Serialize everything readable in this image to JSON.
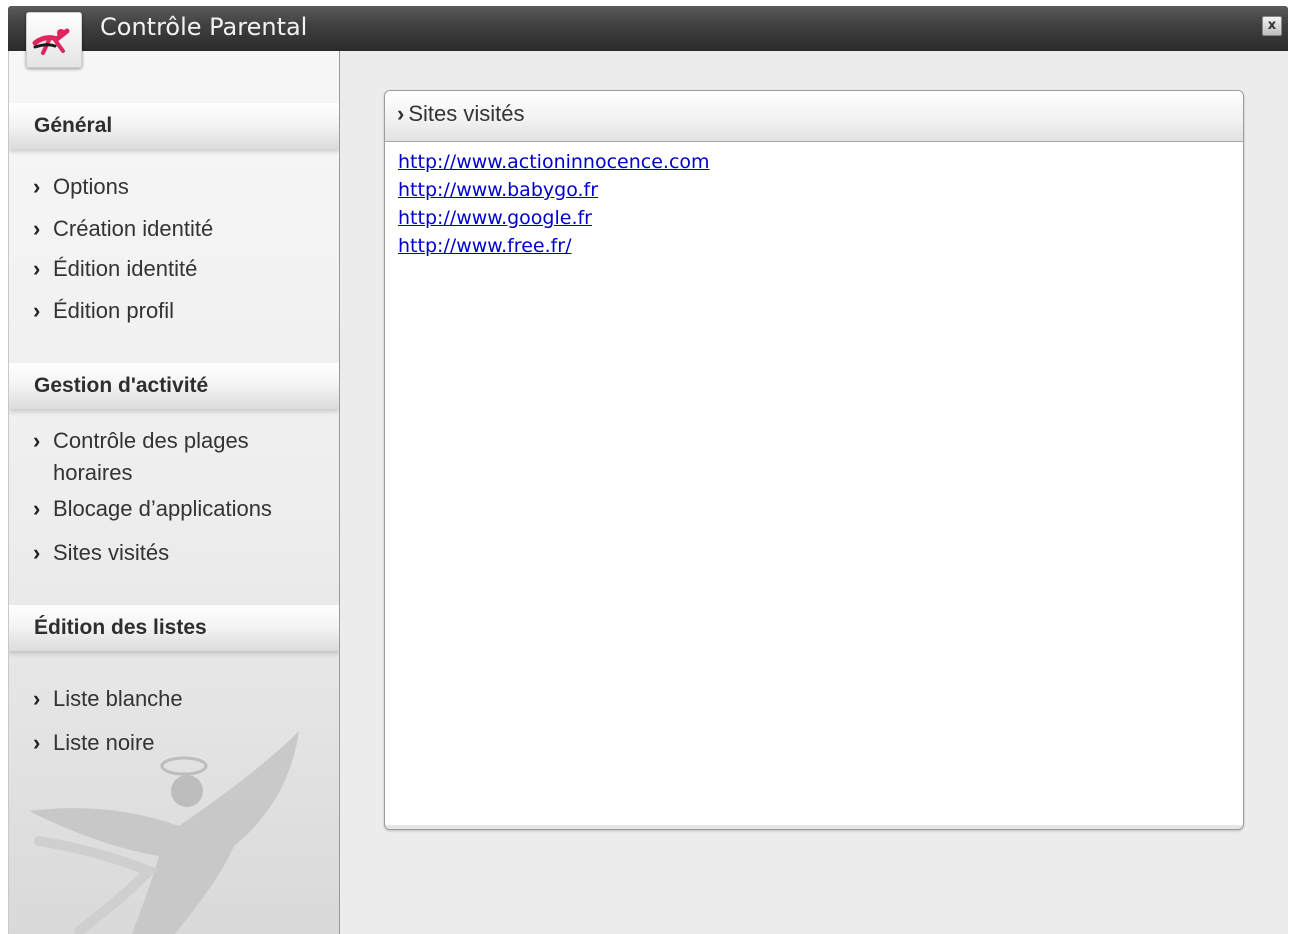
{
  "window": {
    "title": "Contrôle Parental",
    "close_label": "x"
  },
  "sidebar": {
    "sections": [
      {
        "title": "Général",
        "items": [
          "Options",
          "Création identité",
          "Édition identité",
          "Édition profil"
        ]
      },
      {
        "title": "Gestion d'activité",
        "items": [
          "Contrôle des plages horaires",
          "Blocage d’applications",
          "Sites visités"
        ]
      },
      {
        "title": "Édition des listes",
        "items": [
          "Liste blanche",
          "Liste noire"
        ]
      }
    ],
    "item_line2": "horaires",
    "item_line1": "Contrôle des plages"
  },
  "panel": {
    "title": "Sites visités",
    "sites": [
      "http://www.actioninnocence.com",
      "http://www.babygo.fr",
      "http://www.google.fr",
      "http://www.free.fr/"
    ]
  },
  "icons": {
    "logo": "dancing-figure-logo",
    "chevron": "chevron-right-icon",
    "close": "close-icon",
    "emblem": "winged-angel-emblem"
  },
  "colors": {
    "titlebar": "#3f3f3f",
    "link": "#0000cc",
    "logo_accent": "#e0245e"
  }
}
